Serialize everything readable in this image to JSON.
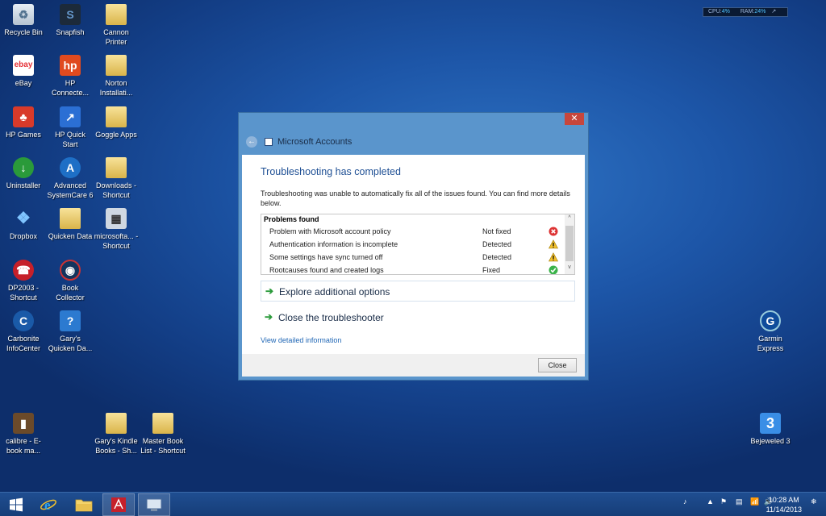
{
  "desktop": {
    "icons": [
      {
        "label": "Recycle Bin",
        "glyph": "♻"
      },
      {
        "label": "Snapfish",
        "glyph": "S"
      },
      {
        "label": "Cannon Printer",
        "glyph": ""
      },
      {
        "label": "eBay",
        "glyph": "ebay"
      },
      {
        "label": "HP Connecte...",
        "glyph": "hp"
      },
      {
        "label": "Norton Installati...",
        "glyph": ""
      },
      {
        "label": "HP Games",
        "glyph": "♣"
      },
      {
        "label": "HP Quick Start",
        "glyph": "↗"
      },
      {
        "label": "Goggle Apps",
        "glyph": ""
      },
      {
        "label": "Uninstaller",
        "glyph": "↓"
      },
      {
        "label": "Advanced SystemCare 6",
        "glyph": "A"
      },
      {
        "label": "Downloads - Shortcut",
        "glyph": ""
      },
      {
        "label": "Dropbox",
        "glyph": "❖"
      },
      {
        "label": "Quicken Data",
        "glyph": ""
      },
      {
        "label": "microsofta... - Shortcut",
        "glyph": "▦"
      },
      {
        "label": "DP2003 - Shortcut",
        "glyph": "☎"
      },
      {
        "label": "Book Collector",
        "glyph": "◉"
      },
      {
        "label": "Carbonite InfoCenter",
        "glyph": "C"
      },
      {
        "label": "Gary's Quicken Da...",
        "glyph": "?"
      },
      {
        "label": "calibre - E-book ma...",
        "glyph": "▮"
      },
      {
        "label": "Gary's Kindle Books - Sh...",
        "glyph": ""
      },
      {
        "label": "Master Book List - Shortcut",
        "glyph": ""
      },
      {
        "label": "Garmin Express",
        "glyph": "G"
      },
      {
        "label": "Bejeweled 3",
        "glyph": "3"
      }
    ]
  },
  "perf_meter": {
    "cpu_label": "CPU:",
    "cpu_value": "4%",
    "ram_label": "RAM:",
    "ram_value": "24%",
    "expand_glyph": "↗"
  },
  "window": {
    "title": "Microsoft Accounts",
    "close_glyph": "✕",
    "back_glyph": "←",
    "heading": "Troubleshooting has completed",
    "description": "Troubleshooting was unable to automatically fix all of the issues found. You can find more details below.",
    "problems_header": "Problems found",
    "problems": [
      {
        "name": "Problem with Microsoft account policy",
        "status": "Not fixed",
        "icon": "error-icon"
      },
      {
        "name": "Authentication information is incomplete",
        "status": "Detected",
        "icon": "warning-icon"
      },
      {
        "name": "Some settings have sync turned off",
        "status": "Detected",
        "icon": "warning-icon"
      },
      {
        "name": "Rootcauses found and created logs",
        "status": "Fixed",
        "icon": "check-icon"
      }
    ],
    "scroll_up": "^",
    "scroll_down": "v",
    "option_arrow": "➔",
    "explore_label": "Explore additional options",
    "close_troubleshooter_label": "Close the troubleshooter",
    "view_details_link": "View detailed information",
    "close_button": "Close"
  },
  "taskbar": {
    "clock_time": "10:28 AM",
    "clock_date": "11/14/2013",
    "tray_glyphs": [
      "♪",
      "▲",
      "⚑",
      "▤",
      "📶",
      "🔊",
      "❄"
    ]
  },
  "colors": {
    "accent": "#1e4f94",
    "link": "#1f66b5",
    "window_frame": "#5a95cc",
    "close_red": "#c7463c"
  }
}
